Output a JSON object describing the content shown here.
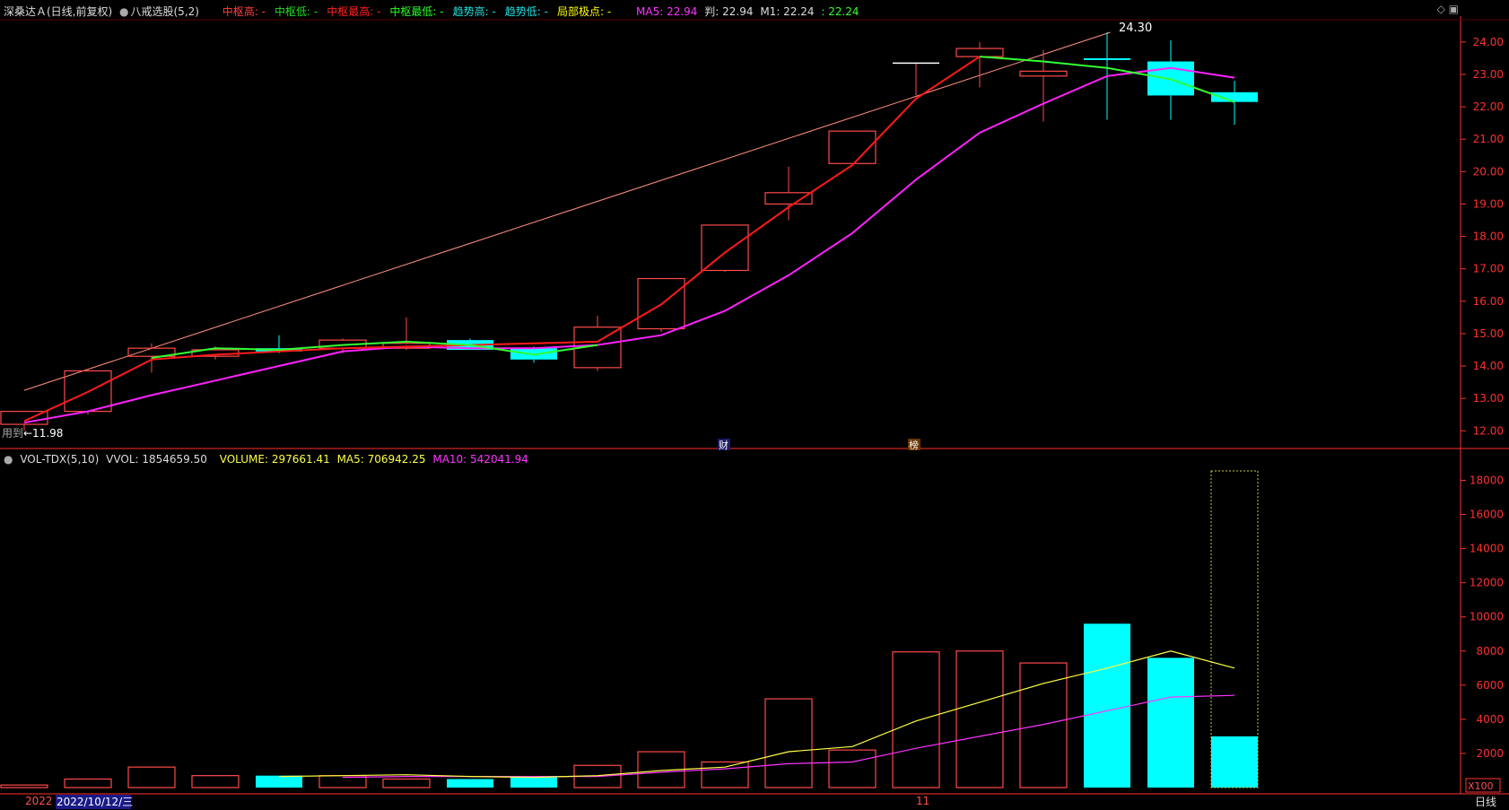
{
  "header": {
    "stock": "深桑达Ａ(日线,前复权)",
    "indicator": "八戒选股(5,2)",
    "items": [
      {
        "label": "中枢高: -",
        "color": "#ff4040"
      },
      {
        "label": "中枢低: -",
        "color": "#22dd22"
      },
      {
        "label": "中枢最高: -",
        "color": "#ff2020"
      },
      {
        "label": "中枢最低: -",
        "color": "#22ff22"
      },
      {
        "label": "趋势高: -",
        "color": "#20e0e0"
      },
      {
        "label": "趋势低: -",
        "color": "#20e0e0"
      },
      {
        "label": "局部极点: -",
        "color": "#ffff00"
      }
    ],
    "ma5": "MA5: 22.94",
    "pan": "判: 22.94",
    "m1": "M1: 22.24",
    "m2": ": 22.24"
  },
  "vol_header": {
    "name": "VOL-TDX(5,10)",
    "vvol": "VVOL: 1854659.50",
    "volume": "VOLUME: 297661.41",
    "ma5": "MA5: 706942.25",
    "ma10": "MA10: 542041.94"
  },
  "annotations": {
    "high_label": "24.30",
    "low_label": "←11.98",
    "low_prefix": "用到",
    "badge1": "财",
    "badge2": "榜",
    "month_marker": "11",
    "vol_unit": "X100",
    "period": "日线",
    "date_prefix": "2022",
    "date_label": "2022/10/12/三"
  },
  "colors": {
    "up": "#ff4a4a",
    "down": "#00ffff",
    "ma_red": "#ff1a1a",
    "ma_magenta": "#ff22ff",
    "ma_green": "#33ff33",
    "vol_ma5": "#ffff44",
    "vol_ma10": "#ff33ff",
    "trendline": "#ff9080",
    "axis": "#ff3030"
  },
  "chart_data": [
    {
      "type": "candlestick",
      "y_ticks": [
        12.0,
        13.0,
        14.0,
        15.0,
        16.0,
        17.0,
        18.0,
        19.0,
        20.0,
        21.0,
        22.0,
        23.0,
        24.0
      ],
      "ylim": [
        11.6,
        24.5
      ],
      "candles": [
        {
          "o": 12.2,
          "h": 12.6,
          "l": 12.0,
          "c": 12.6
        },
        {
          "o": 12.6,
          "h": 13.9,
          "l": 12.5,
          "c": 13.85
        },
        {
          "o": 14.3,
          "h": 14.7,
          "l": 13.8,
          "c": 14.55
        },
        {
          "o": 14.3,
          "h": 14.6,
          "l": 14.2,
          "c": 14.5
        },
        {
          "o": 14.55,
          "h": 14.95,
          "l": 14.4,
          "c": 14.45
        },
        {
          "o": 14.55,
          "h": 14.85,
          "l": 14.4,
          "c": 14.8
        },
        {
          "o": 14.55,
          "h": 15.5,
          "l": 14.5,
          "c": 14.7
        },
        {
          "o": 14.8,
          "h": 14.85,
          "l": 14.5,
          "c": 14.5
        },
        {
          "o": 14.55,
          "h": 14.6,
          "l": 14.1,
          "c": 14.2
        },
        {
          "o": 13.95,
          "h": 15.55,
          "l": 13.85,
          "c": 15.2
        },
        {
          "o": 15.15,
          "h": 16.7,
          "l": 15.05,
          "c": 16.7
        },
        {
          "o": 16.95,
          "h": 18.35,
          "l": 16.9,
          "c": 18.35
        },
        {
          "o": 19.0,
          "h": 20.15,
          "l": 18.5,
          "c": 19.35
        },
        {
          "o": 20.25,
          "h": 21.25,
          "l": 20.25,
          "c": 21.25
        },
        {
          "o": 23.35,
          "h": 23.35,
          "l": 22.35,
          "c": 23.35
        },
        {
          "o": 23.55,
          "h": 24.0,
          "l": 22.6,
          "c": 23.8
        },
        {
          "o": 22.95,
          "h": 23.75,
          "l": 21.55,
          "c": 23.1
        },
        {
          "o": 23.5,
          "h": 24.3,
          "l": 21.6,
          "c": 23.45
        },
        {
          "o": 23.4,
          "h": 24.05,
          "l": 21.6,
          "c": 22.35
        },
        {
          "o": 22.45,
          "h": 22.8,
          "l": 21.45,
          "c": 22.15
        }
      ],
      "ma_red": [
        null,
        null,
        14.2,
        14.35,
        14.45,
        14.55,
        14.6,
        14.65,
        14.7,
        14.75,
        15.9,
        17.5,
        18.9,
        20.2,
        22.25,
        23.55,
        null,
        null,
        null,
        null
      ],
      "ma_red_start": [
        12.3,
        13.2,
        14.2
      ],
      "ma_magenta": [
        12.25,
        12.6,
        13.1,
        13.55,
        14.0,
        14.45,
        14.6,
        14.55,
        14.55,
        14.65,
        14.95,
        15.7,
        16.8,
        18.1,
        19.75,
        21.2,
        22.1,
        22.95,
        23.2,
        22.9
      ],
      "ma_green": [
        null,
        null,
        14.25,
        14.55,
        14.5,
        14.65,
        14.75,
        14.65,
        14.35,
        14.65,
        null,
        null,
        null,
        null,
        null,
        23.55,
        23.4,
        23.2,
        22.85,
        22.15
      ],
      "trendline": {
        "from": {
          "i": 0,
          "v": 13.25
        },
        "to": {
          "i": 17.05,
          "v": 24.3
        }
      }
    },
    {
      "type": "bar",
      "unit": "X100",
      "y_ticks": [
        2000,
        4000,
        6000,
        8000,
        10000,
        12000,
        14000,
        16000,
        18000
      ],
      "ylim": [
        0,
        18800
      ],
      "volumes": [
        150,
        500,
        1200,
        700,
        700,
        700,
        500,
        500,
        600,
        1300,
        2100,
        1500,
        5200,
        2200,
        7950,
        8000,
        7300,
        9600,
        7600,
        3000
      ],
      "direction": [
        "up",
        "up",
        "up",
        "up",
        "down",
        "up",
        "up",
        "down",
        "down",
        "up",
        "up",
        "up",
        "up",
        "up",
        "up",
        "up",
        "up",
        "down",
        "down",
        "down"
      ],
      "projected_last": 18550,
      "ma5": [
        null,
        null,
        null,
        null,
        650,
        700,
        750,
        650,
        600,
        700,
        1000,
        1200,
        2100,
        2400,
        3900,
        5000,
        6100,
        7000,
        8000,
        7000
      ],
      "ma10": [
        null,
        null,
        null,
        null,
        null,
        600,
        650,
        650,
        650,
        650,
        900,
        1100,
        1400,
        1500,
        2300,
        3000,
        3700,
        4500,
        5300,
        5400
      ]
    }
  ]
}
